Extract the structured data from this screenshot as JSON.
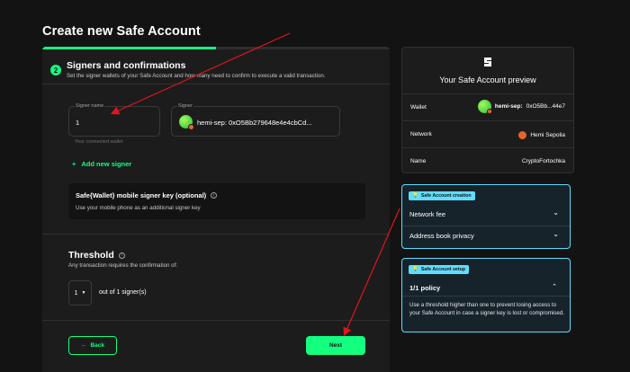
{
  "page": {
    "title": "Create new Safe Account"
  },
  "step": {
    "number": "2",
    "title": "Signers and confirmations",
    "description": "Set the signer wallets of your Safe Account and how many need to confirm to execute a valid transaction.",
    "progress_percent": 50
  },
  "signer_name": {
    "label": "Signer name",
    "value": "1",
    "helper": "Your connected wallet"
  },
  "signer": {
    "label": "Signer",
    "value": "hemi-sep: 0xO5Bb279648e4e4cbCd..."
  },
  "add_signer": {
    "label": "Add new signer",
    "icon": "plus-icon"
  },
  "mobile_signer": {
    "title": "Safe{Wallet} mobile signer key (optional)",
    "description": "Use your mobile phone as an additional signer key"
  },
  "threshold": {
    "title": "Threshold",
    "description": "Any transaction requires the confirmation of:",
    "selected": "1",
    "out_of": "out of 1 signer(s)"
  },
  "buttons": {
    "back": "Back",
    "next": "Next"
  },
  "preview": {
    "title": "Your Safe Account preview",
    "wallet_label": "Wallet",
    "wallet_prefix": "hemi-sep:",
    "wallet_value": "0xO5Bb...44e7",
    "network_label": "Network",
    "network_value": "Hemi Sepolia",
    "name_label": "Name",
    "name_value": "CryptoFortochka"
  },
  "creation_box": {
    "chip": "Safe Account creation",
    "network_fee": "Network fee",
    "address_book": "Address book privacy"
  },
  "setup_box": {
    "chip": "Safe Account setup",
    "policy": "1/1 policy",
    "description": "Use a threshold higher than one to prevent losing access to your Safe Account in case a signer key is lost or compromised."
  },
  "colors": {
    "accent": "#12ff80",
    "info": "#5fddff",
    "annotation": "#e0141e",
    "background": "#121312",
    "card": "#1c1c1c"
  }
}
